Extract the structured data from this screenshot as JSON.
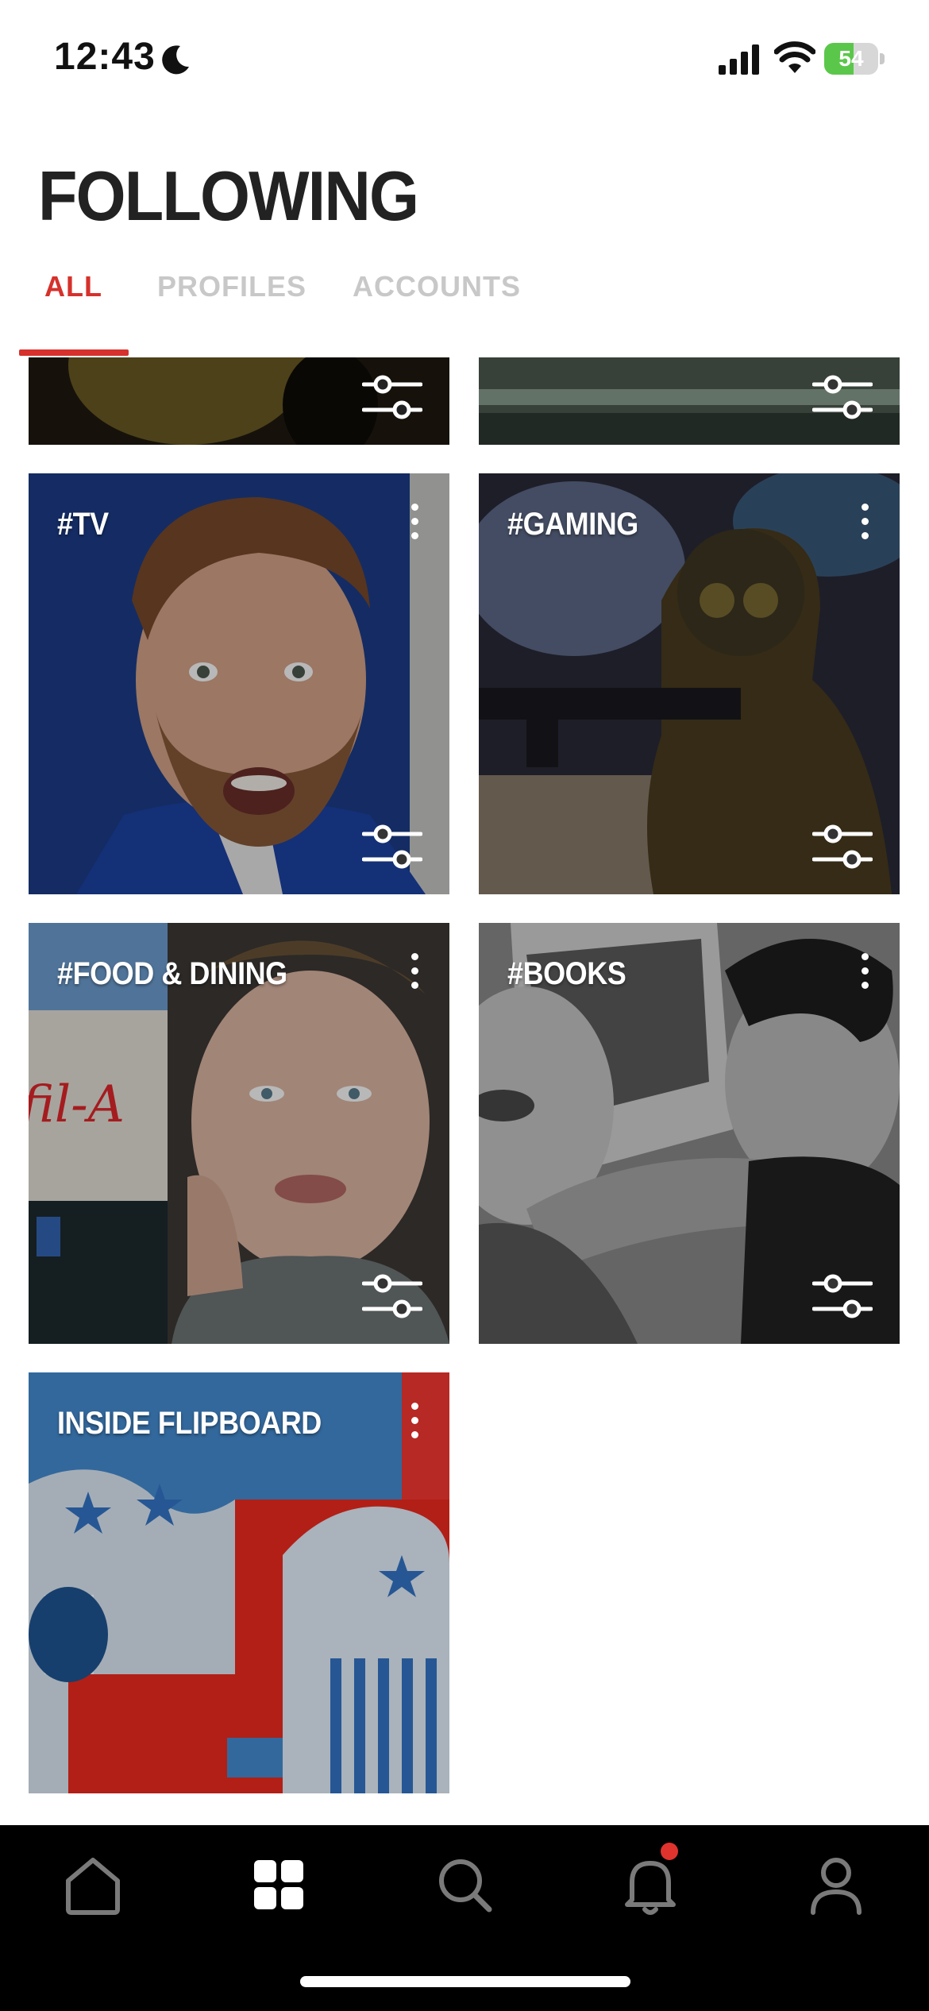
{
  "status_bar": {
    "time": "12:43",
    "battery_level": "54",
    "battery_fraction": 0.54,
    "icons": [
      "moon-icon",
      "cellular-signal-icon",
      "wifi-icon",
      "battery-charging-icon"
    ]
  },
  "header": {
    "title": "FOLLOWING",
    "tabs": [
      {
        "label": "ALL",
        "active": true
      },
      {
        "label": "PROFILES",
        "active": false
      },
      {
        "label": "ACCOUNTS",
        "active": false
      }
    ],
    "accent_color": "#d6312c"
  },
  "grid": {
    "tiles": [
      {
        "title": "",
        "partial": true
      },
      {
        "title": "",
        "partial": true
      },
      {
        "title": "#TV"
      },
      {
        "title": "#GAMING"
      },
      {
        "title": "#FOOD & DINING"
      },
      {
        "title": "#BOOKS"
      },
      {
        "title": "INSIDE FLIPBOARD"
      }
    ]
  },
  "tab_bar": {
    "items": [
      "home-icon",
      "grid-icon",
      "search-icon",
      "notifications-bell-icon",
      "profile-icon"
    ],
    "active_item": "grid-icon",
    "notification_dot_color": "#e0332e"
  }
}
